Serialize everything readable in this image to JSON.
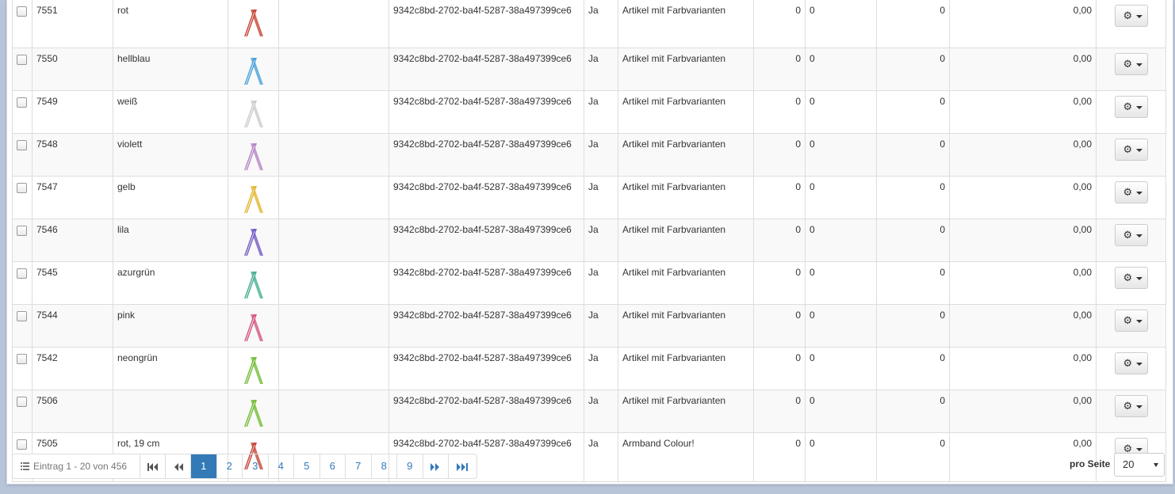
{
  "rows": [
    {
      "id": "7551",
      "name": "rot",
      "guid": "9342c8bd-2702-ba4f-5287-38a497399ce6",
      "active": "Ja",
      "category": "Artikel mit Farbvarianten",
      "q1": "0",
      "q2": "0",
      "q3": "0",
      "price": "0,00",
      "thumb_color": "#c0392b"
    },
    {
      "id": "7550",
      "name": "hellblau",
      "guid": "9342c8bd-2702-ba4f-5287-38a497399ce6",
      "active": "Ja",
      "category": "Artikel mit Farbvarianten",
      "q1": "0",
      "q2": "0",
      "q3": "0",
      "price": "0,00",
      "thumb_color": "#3d9ad6"
    },
    {
      "id": "7549",
      "name": "weiß",
      "guid": "9342c8bd-2702-ba4f-5287-38a497399ce6",
      "active": "Ja",
      "category": "Artikel mit Farbvarianten",
      "q1": "0",
      "q2": "0",
      "q3": "0",
      "price": "0,00",
      "thumb_color": "#c8c8c8"
    },
    {
      "id": "7548",
      "name": "violett",
      "guid": "9342c8bd-2702-ba4f-5287-38a497399ce6",
      "active": "Ja",
      "category": "Artikel mit Farbvarianten",
      "q1": "0",
      "q2": "0",
      "q3": "0",
      "price": "0,00",
      "thumb_color": "#b07cc0"
    },
    {
      "id": "7547",
      "name": "gelb",
      "guid": "9342c8bd-2702-ba4f-5287-38a497399ce6",
      "active": "Ja",
      "category": "Artikel mit Farbvarianten",
      "q1": "0",
      "q2": "0",
      "q3": "0",
      "price": "0,00",
      "thumb_color": "#e0b020"
    },
    {
      "id": "7546",
      "name": "lila",
      "guid": "9342c8bd-2702-ba4f-5287-38a497399ce6",
      "active": "Ja",
      "category": "Artikel mit Farbvarianten",
      "q1": "0",
      "q2": "0",
      "q3": "0",
      "price": "0,00",
      "thumb_color": "#6a4fc0"
    },
    {
      "id": "7545",
      "name": "azurgrün",
      "guid": "9342c8bd-2702-ba4f-5287-38a497399ce6",
      "active": "Ja",
      "category": "Artikel mit Farbvarianten",
      "q1": "0",
      "q2": "0",
      "q3": "0",
      "price": "0,00",
      "thumb_color": "#3aa88a"
    },
    {
      "id": "7544",
      "name": "pink",
      "guid": "9342c8bd-2702-ba4f-5287-38a497399ce6",
      "active": "Ja",
      "category": "Artikel mit Farbvarianten",
      "q1": "0",
      "q2": "0",
      "q3": "0",
      "price": "0,00",
      "thumb_color": "#d04a78"
    },
    {
      "id": "7542",
      "name": "neongrün",
      "guid": "9342c8bd-2702-ba4f-5287-38a497399ce6",
      "active": "Ja",
      "category": "Artikel mit Farbvarianten",
      "q1": "0",
      "q2": "0",
      "q3": "0",
      "price": "0,00",
      "thumb_color": "#6ab82a"
    },
    {
      "id": "7506",
      "name": "",
      "guid": "9342c8bd-2702-ba4f-5287-38a497399ce6",
      "active": "Ja",
      "category": "Artikel mit Farbvarianten",
      "q1": "0",
      "q2": "0",
      "q3": "0",
      "price": "0,00",
      "thumb_color": "#6ab82a"
    },
    {
      "id": "7505",
      "name": "rot, 19 cm",
      "guid": "9342c8bd-2702-ba4f-5287-38a497399ce6",
      "active": "Ja",
      "category": "Armband Colour!",
      "q1": "0",
      "q2": "0",
      "q3": "0",
      "price": "0,00",
      "thumb_color": "#c0392b"
    }
  ],
  "pagination": {
    "info": "Eintrag 1 - 20 von 456",
    "pages": [
      "1",
      "2",
      "3",
      "4",
      "5",
      "6",
      "7",
      "8",
      "9"
    ],
    "active_page": "1"
  },
  "per_page": {
    "label": "pro Seite",
    "value": "20"
  },
  "colors": {
    "accent": "#337ab7",
    "border": "#dddddd"
  }
}
